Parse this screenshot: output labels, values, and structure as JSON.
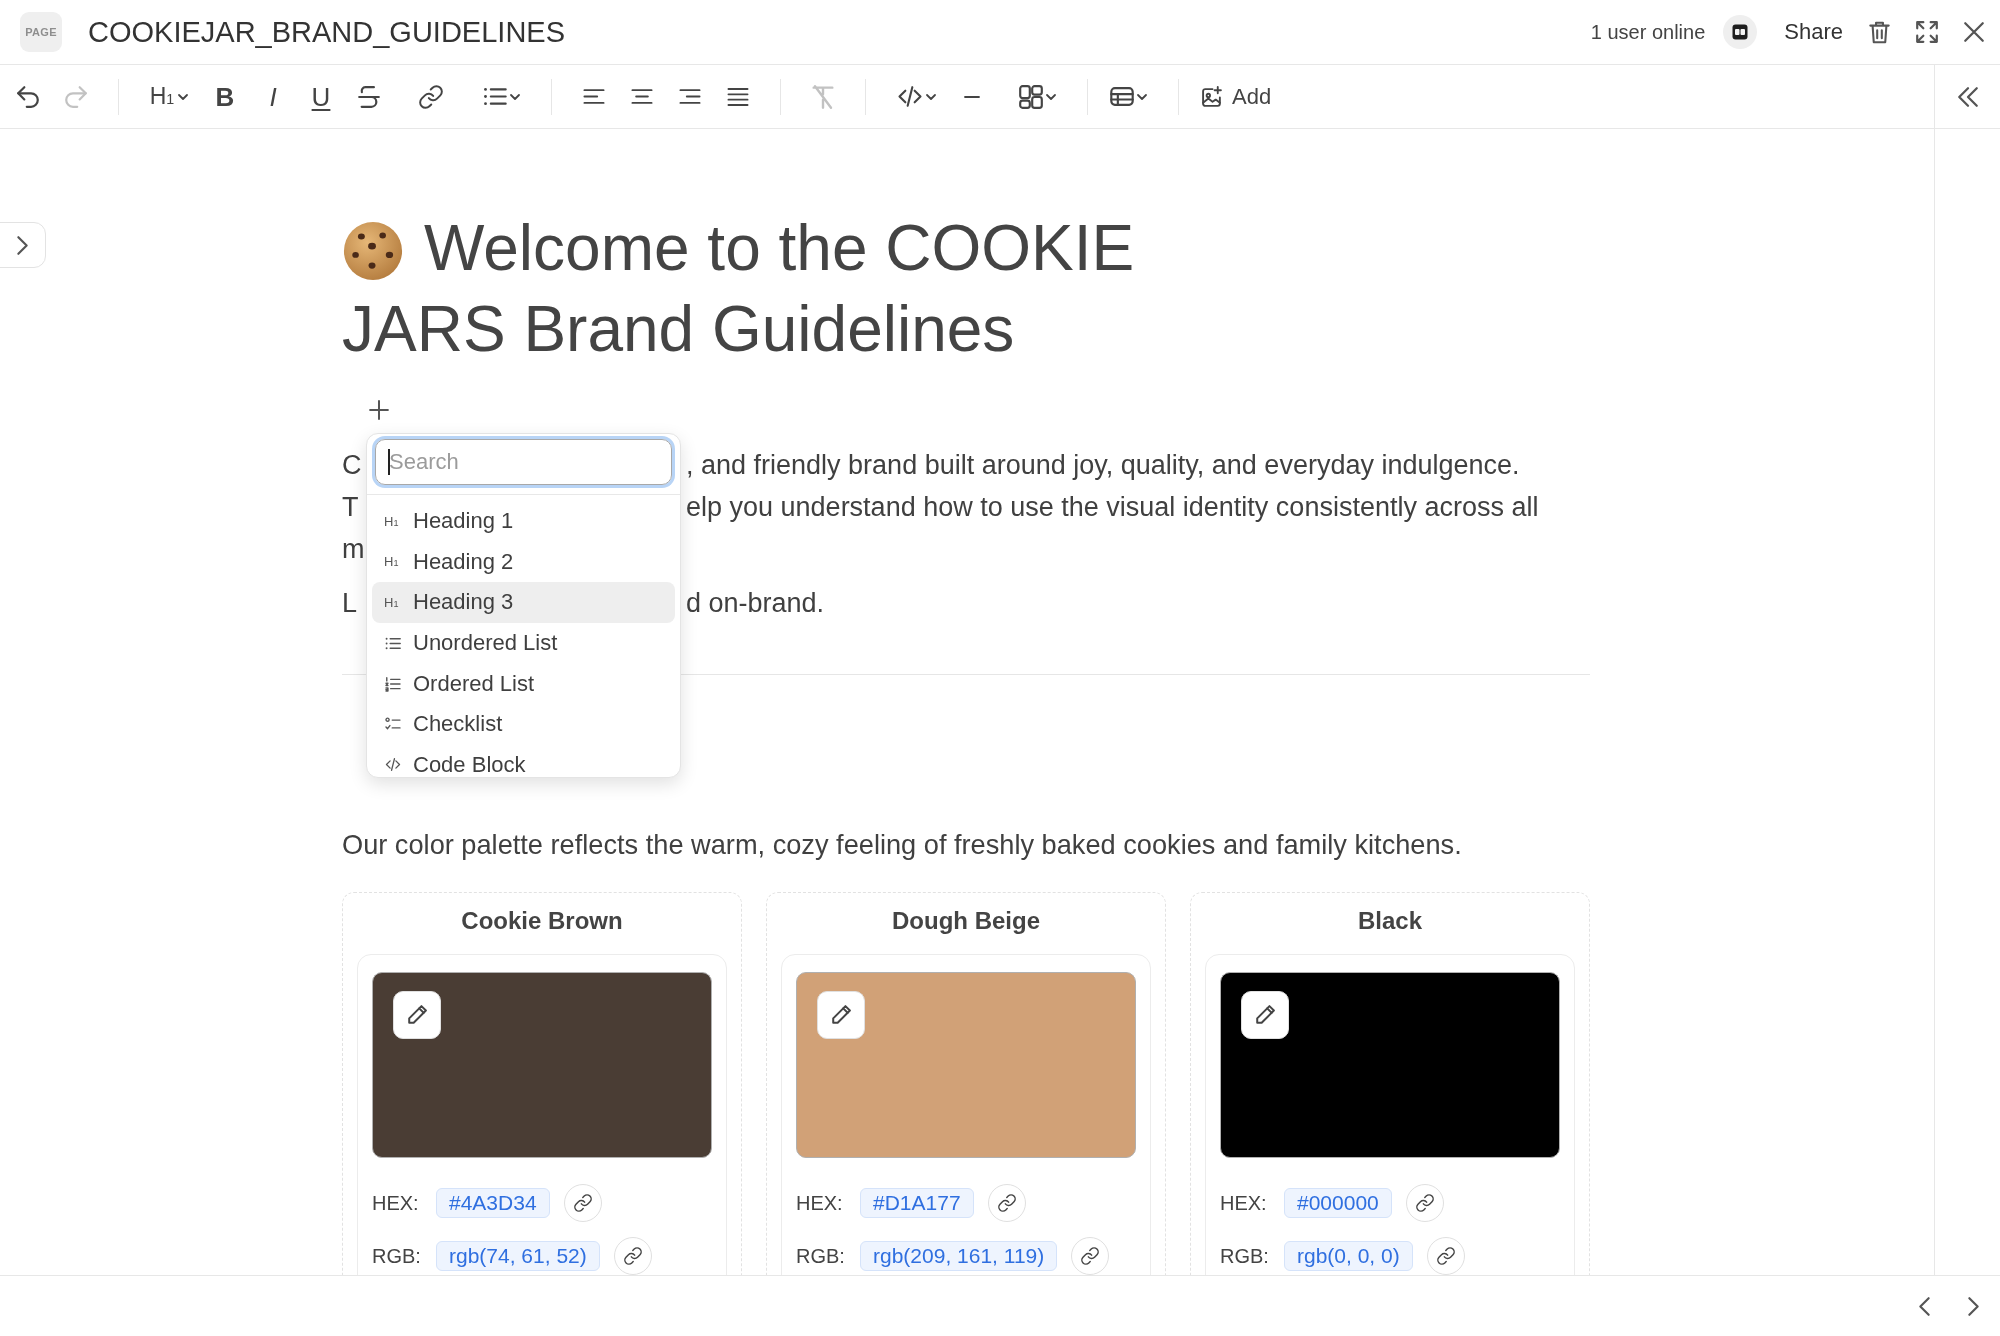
{
  "header": {
    "badge": "PAGE",
    "title": "COOKIEJAR_BRAND_GUIDELINES",
    "presence": "1 user online",
    "share": "Share"
  },
  "toolbar": {
    "groups": [
      [
        {
          "kind": "undo",
          "disabled": false
        },
        {
          "kind": "redo",
          "disabled": true
        }
      ],
      [
        {
          "kind": "heading",
          "glyph": "H$_{1}$",
          "dropdown": true,
          "disabled": false
        },
        {
          "kind": "bold",
          "glyph": "B",
          "disabled": false
        },
        {
          "kind": "italic",
          "glyph": "I",
          "disabled": false
        },
        {
          "kind": "underline",
          "glyph": "U",
          "disabled": false
        },
        {
          "kind": "strike",
          "disabled": false
        },
        {
          "kind": "link",
          "disabled": false
        },
        {
          "kind": "list",
          "dropdown": true,
          "disabled": false
        }
      ],
      [
        {
          "kind": "align-left",
          "disabled": false
        },
        {
          "kind": "align-center",
          "disabled": false
        },
        {
          "kind": "align-right",
          "disabled": false
        },
        {
          "kind": "justify",
          "disabled": false
        }
      ],
      [
        {
          "kind": "clear-format",
          "disabled": true
        }
      ],
      [
        {
          "kind": "code",
          "dropdown": true,
          "disabled": false
        },
        {
          "kind": "divider",
          "disabled": false
        },
        {
          "kind": "layout",
          "dropdown": true,
          "disabled": false
        }
      ],
      [
        {
          "kind": "table",
          "dropdown": true,
          "disabled": false
        }
      ],
      [
        {
          "kind": "image",
          "label": "Add",
          "disabled": false
        }
      ]
    ]
  },
  "document": {
    "title_lines": [
      "Welcome to the COOKIE",
      "JARS Brand Guidelines"
    ],
    "paragraphs": [
      {
        "lines": [
          {
            "left": "C",
            "right": ", and friendly brand built around joy, quality, and everyday indulgence."
          },
          {
            "left": "T",
            "right": "elp you understand how to use the visual identity consistently across all"
          },
          {
            "left": "m"
          }
        ]
      },
      {
        "lines": [
          {
            "left": "L",
            "right": "d on-brand."
          }
        ]
      }
    ]
  },
  "block_menu": {
    "search": {
      "placeholder": "Search",
      "focused": true
    },
    "items": [
      {
        "kind": "heading",
        "glyph": "H$_{1}$",
        "label": "Heading 1",
        "selected": false
      },
      {
        "kind": "heading",
        "glyph": "H$_{1}$",
        "label": "Heading 2",
        "selected": false
      },
      {
        "kind": "heading",
        "glyph": "H$_{1}$",
        "label": "Heading 3",
        "selected": true
      },
      {
        "kind": "bullet-list",
        "label": "Unordered List",
        "selected": false
      },
      {
        "kind": "ordered-list",
        "label": "Ordered List",
        "selected": false
      },
      {
        "kind": "checklist",
        "label": "Checklist",
        "selected": false
      },
      {
        "kind": "code",
        "label": "Code Block",
        "selected": false
      }
    ]
  },
  "palette": {
    "intro": "Our color palette reflects the warm, cozy feeling of freshly baked cookies and family kitchens.",
    "colors": [
      {
        "name": "Cookie Brown",
        "color": "#4a3d34",
        "hex_label": "HEX:",
        "hex": "#4A3D34",
        "rgb_label": "RGB:",
        "rgb": "rgb(74, 61, 52)"
      },
      {
        "name": "Dough Beige",
        "color": "#d1a177",
        "hex_label": "HEX:",
        "hex": "#D1A177",
        "rgb_label": "RGB:",
        "rgb": "rgb(209, 161, 119)"
      },
      {
        "name": "Black",
        "color": "#000000",
        "hex_label": "HEX:",
        "hex": "#000000",
        "rgb_label": "RGB:",
        "rgb": "rgb(0, 0, 0)"
      }
    ]
  }
}
